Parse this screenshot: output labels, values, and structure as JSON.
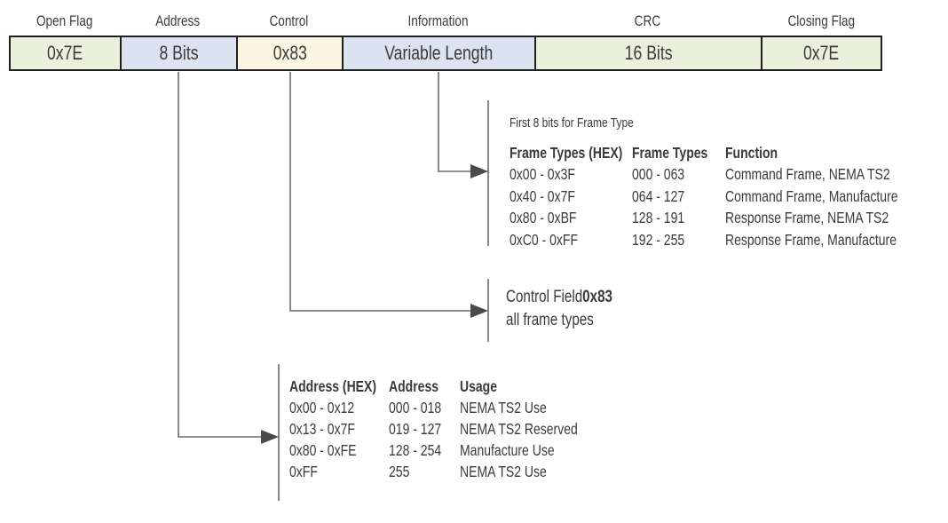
{
  "frame": {
    "fields": [
      {
        "label": "Open Flag",
        "value": "0x7E",
        "color": "#ebf0dc"
      },
      {
        "label": "Address",
        "value": "8 Bits",
        "color": "#dae3ef"
      },
      {
        "label": "Control",
        "value": "0x83",
        "color": "#fdf5e3"
      },
      {
        "label": "Information",
        "value": "Variable Length",
        "color": "#dae3ef"
      },
      {
        "label": "CRC",
        "value": "16 Bits",
        "color": "#ebf0dc"
      },
      {
        "label": "Closing Flag",
        "value": "0x7E",
        "color": "#ebf0dc"
      }
    ]
  },
  "information_note": {
    "caption": "First 8 bits for Frame Type",
    "headers": [
      "Frame Types (HEX)",
      "Frame Types",
      "Function"
    ],
    "rows": [
      [
        "0x00 - 0x3F",
        "000 - 063",
        "Command Frame, NEMA TS2"
      ],
      [
        "0x40 - 0x7F",
        "064 - 127",
        "Command Frame, Manufacture"
      ],
      [
        "0x80 - 0xBF",
        "128  - 191",
        "Response Frame, NEMA TS2"
      ],
      [
        "0xC0 - 0xFF",
        "192  - 255",
        "Response Frame, Manufacture"
      ]
    ]
  },
  "control_note": {
    "line1_prefix": "Control Field ",
    "line1_bold": "0x83",
    "line2": "all frame types"
  },
  "address_note": {
    "headers": [
      "Address (HEX)",
      "Address",
      "Usage"
    ],
    "rows": [
      [
        "0x00 - 0x12",
        "000 - 018",
        "NEMA TS2  Use"
      ],
      [
        "0x13  - 0x7F",
        "019  - 127",
        "NEMA TS2 Reserved"
      ],
      [
        "0x80 - 0xFE",
        "128  - 254",
        "Manufacture Use"
      ],
      [
        "0xFF",
        "255",
        "NEMA TS2 Use"
      ]
    ]
  }
}
